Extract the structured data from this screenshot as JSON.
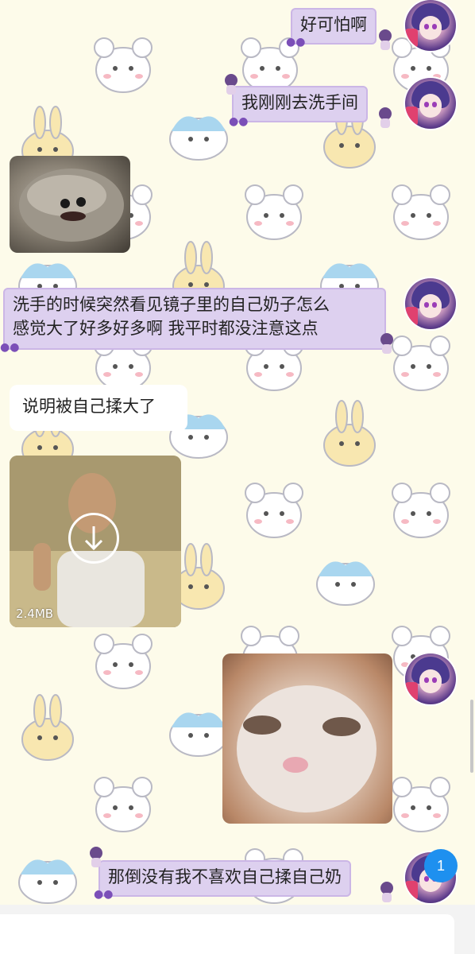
{
  "messages": [
    {
      "side": "right",
      "type": "text",
      "text": "好可怕啊"
    },
    {
      "side": "right",
      "type": "text",
      "text": "我刚刚去洗手间"
    },
    {
      "side": "left",
      "type": "image",
      "icon": "seal-sticker"
    },
    {
      "side": "right",
      "type": "text",
      "lines": [
        "洗手的时候突然看见镜子里的自己奶子怎么",
        "感觉大了好多好多啊 我平时都没注意这点"
      ]
    },
    {
      "side": "left",
      "type": "text",
      "text": "说明被自己揉大了"
    },
    {
      "side": "left",
      "type": "video",
      "size": "2.4MB",
      "icon": "download-icon"
    },
    {
      "side": "right",
      "type": "image",
      "icon": "cat-sticker"
    },
    {
      "side": "right",
      "type": "text",
      "text": "那倒没有我不喜欢自己揉自己奶"
    }
  ],
  "unread_badge": "1",
  "input": {
    "placeholder": ""
  },
  "colors": {
    "background": "#fdfbea",
    "bubble_purple": "#ddd0ef",
    "bubble_border": "#cbb6e6",
    "bubble_white": "#ffffff",
    "badge": "#1e90ef"
  }
}
